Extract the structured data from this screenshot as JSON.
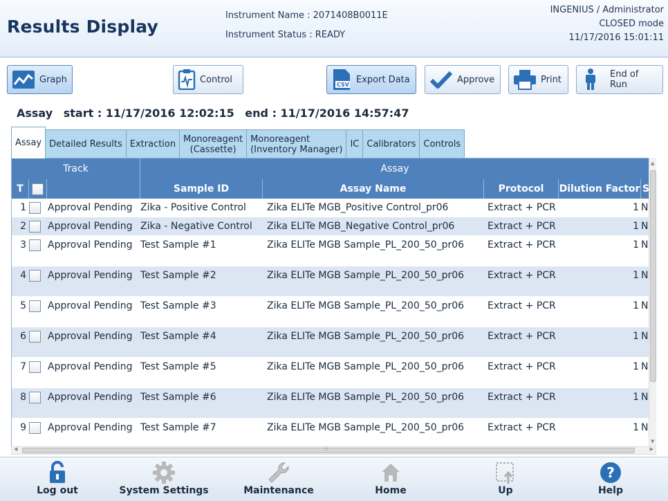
{
  "header": {
    "title": "Results Display",
    "instrument_name": "Instrument Name : 2071408B0011E",
    "instrument_status": "Instrument Status : READY",
    "user": "INGENIUS / Administrator",
    "mode": "CLOSED mode",
    "datetime": "11/17/2016 15:01:11"
  },
  "toolbar": {
    "graph": "Graph",
    "control": "Control",
    "export_data": "Export Data",
    "approve": "Approve",
    "print": "Print",
    "end_of_run": "End of Run"
  },
  "assay_line": {
    "label": "Assay",
    "start": "start : 11/17/2016 12:02:15",
    "end": "end : 11/17/2016 14:57:47"
  },
  "tabs": [
    {
      "line1": "Assay",
      "line2": ""
    },
    {
      "line1": "Detailed Results",
      "line2": ""
    },
    {
      "line1": "Extraction",
      "line2": ""
    },
    {
      "line1": "Monoreagent",
      "line2": "(Cassette)"
    },
    {
      "line1": "Monoreagent",
      "line2": "(Inventory Manager)"
    },
    {
      "line1": "IC",
      "line2": ""
    },
    {
      "line1": "Calibrators",
      "line2": ""
    },
    {
      "line1": "Controls",
      "line2": ""
    }
  ],
  "table": {
    "group_headers": {
      "track": "Track",
      "assay": "Assay"
    },
    "columns": {
      "t": "T",
      "sample_id": "Sample ID",
      "assay_name": "Assay Name",
      "protocol": "Protocol",
      "dilution_factor": "Dilution Factor",
      "s": "S"
    },
    "rows": [
      {
        "t": "1",
        "status": "Approval Pending",
        "sample_id": "Zika - Positive Control",
        "assay_name": "Zika ELITe MGB_Positive Control_pr06",
        "protocol": "Extract + PCR",
        "dilution": "1",
        "s": "N"
      },
      {
        "t": "2",
        "status": "Approval Pending",
        "sample_id": "Zika - Negative Control",
        "assay_name": "Zika ELITe MGB_Negative Control_pr06",
        "protocol": "Extract + PCR",
        "dilution": "1",
        "s": "N"
      },
      {
        "t": "3",
        "status": "Approval Pending",
        "sample_id": "Test Sample #1",
        "assay_name": "Zika ELITe MGB Sample_PL_200_50_pr06",
        "protocol": "Extract + PCR",
        "dilution": "1",
        "s": "N"
      },
      {
        "t": "4",
        "status": "Approval Pending",
        "sample_id": "Test Sample #2",
        "assay_name": "Zika ELITe MGB Sample_PL_200_50_pr06",
        "protocol": "Extract + PCR",
        "dilution": "1",
        "s": "N"
      },
      {
        "t": "5",
        "status": "Approval Pending",
        "sample_id": "Test Sample #3",
        "assay_name": "Zika ELITe MGB Sample_PL_200_50_pr06",
        "protocol": "Extract + PCR",
        "dilution": "1",
        "s": "N"
      },
      {
        "t": "6",
        "status": "Approval Pending",
        "sample_id": "Test Sample #4",
        "assay_name": "Zika ELITe MGB Sample_PL_200_50_pr06",
        "protocol": "Extract + PCR",
        "dilution": "1",
        "s": "N"
      },
      {
        "t": "7",
        "status": "Approval Pending",
        "sample_id": "Test Sample #5",
        "assay_name": "Zika ELITe MGB Sample_PL_200_50_pr06",
        "protocol": "Extract + PCR",
        "dilution": "1",
        "s": "N"
      },
      {
        "t": "8",
        "status": "Approval Pending",
        "sample_id": "Test Sample #6",
        "assay_name": "Zika ELITe MGB Sample_PL_200_50_pr06",
        "protocol": "Extract + PCR",
        "dilution": "1",
        "s": "N"
      },
      {
        "t": "9",
        "status": "Approval Pending",
        "sample_id": "Test Sample #7",
        "assay_name": "Zika ELITe MGB Sample_PL_200_50_pr06",
        "protocol": "Extract + PCR",
        "dilution": "1",
        "s": "N"
      }
    ]
  },
  "footer": {
    "logout": "Log out",
    "system_settings": "System Settings",
    "maintenance": "Maintenance",
    "home": "Home",
    "up": "Up",
    "help": "Help"
  },
  "colors": {
    "header_blue": "#4f81bd",
    "row_alt": "#dce6f2",
    "tab_blue": "#b4d8ee",
    "title_navy": "#17365d"
  }
}
